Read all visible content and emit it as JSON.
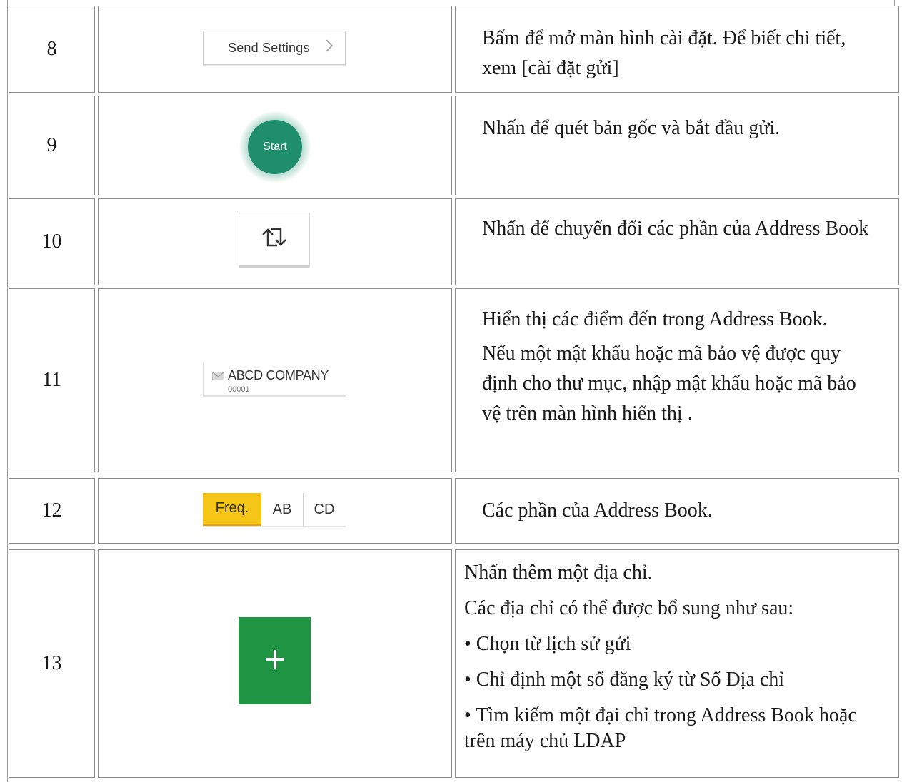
{
  "rows": [
    {
      "number": "8",
      "widget_label": "Send Settings",
      "widget_icon": "chevron-right-icon",
      "description": [
        "Bấm để mở màn hình cài đặt. Để biết chi tiết, xem [cài đặt gửi]"
      ]
    },
    {
      "number": "9",
      "widget_label": "Start",
      "description": [
        "Nhấn để quét bản gốc và bắt đầu gửi."
      ]
    },
    {
      "number": "10",
      "widget_icon": "switch-arrows-icon",
      "description": [
        "Nhấn để chuyển đổi các phần của Address Book"
      ]
    },
    {
      "number": "11",
      "widget_icon": "envelope-icon",
      "entry_name": "ABCD COMPANY",
      "entry_code": "00001",
      "description": [
        "Hiển thị các điểm đến trong Address Book.",
        "Nếu một mật khẩu hoặc mã bảo vệ được quy định cho thư mục, nhập mật khẩu hoặc mã bảo vệ trên màn hình hiển thị ."
      ]
    },
    {
      "number": "12",
      "tabs": [
        "Freq.",
        "AB",
        "CD"
      ],
      "description": [
        "Các phần của Address Book."
      ]
    },
    {
      "number": "13",
      "widget_icon": "plus-icon",
      "description": [
        "Nhấn thêm một địa chỉ.",
        "Các địa chỉ có thể được bổ sung như sau:",
        "• Chọn từ lịch sử gửi",
        "• Chỉ định một số đăng ký từ Sổ Địa chỉ",
        "• Tìm kiếm một đại chỉ trong Address Book hoặc trên máy chủ LDAP"
      ]
    }
  ],
  "colors": {
    "start_green": "#1f8f6b",
    "add_green": "#1f9442",
    "freq_yellow": "#f5c518",
    "border": "#8c8c8c"
  }
}
